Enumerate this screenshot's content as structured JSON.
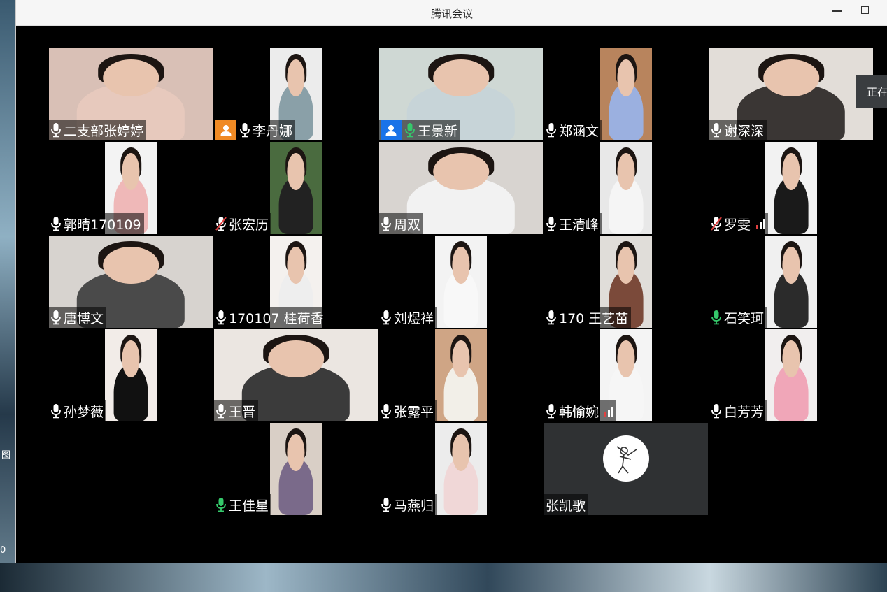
{
  "window": {
    "title": "腾讯会议"
  },
  "toast": {
    "text": "正在"
  },
  "desktop": {
    "left_fragment_1": "图",
    "left_fragment_2": "0"
  },
  "participants": [
    {
      "name": "二支部张婷婷",
      "mic": "on",
      "host": "none"
    },
    {
      "name": "李丹娜",
      "mic": "on",
      "host": "co-host"
    },
    {
      "name": "王景新",
      "mic": "active",
      "host": "host",
      "active": true
    },
    {
      "name": "郑涵文",
      "mic": "on",
      "host": "none"
    },
    {
      "name": "谢深深",
      "mic": "on",
      "host": "none"
    },
    {
      "name": "郭晴170109",
      "mic": "on",
      "host": "none"
    },
    {
      "name": "张宏历",
      "mic": "muted",
      "host": "none"
    },
    {
      "name": "周双",
      "mic": "on",
      "host": "none"
    },
    {
      "name": "王清峰",
      "mic": "on",
      "host": "none"
    },
    {
      "name": "罗雯",
      "mic": "muted",
      "host": "none",
      "signal": "weak"
    },
    {
      "name": "唐博文",
      "mic": "on",
      "host": "none"
    },
    {
      "name": "170107 桂荷香",
      "mic": "on",
      "host": "none"
    },
    {
      "name": "刘煜祥",
      "mic": "on",
      "host": "none"
    },
    {
      "name": "170 王艺苗",
      "mic": "on",
      "host": "none"
    },
    {
      "name": "石笑珂",
      "mic": "active",
      "host": "none"
    },
    {
      "name": "孙梦薇",
      "mic": "on",
      "host": "none"
    },
    {
      "name": "王晋",
      "mic": "on",
      "host": "none"
    },
    {
      "name": "张露平",
      "mic": "on",
      "host": "none"
    },
    {
      "name": "韩愉婉",
      "mic": "on",
      "host": "none",
      "signal": "weak"
    },
    {
      "name": "白芳芳",
      "mic": "on",
      "host": "none"
    },
    {
      "name": "王佳星",
      "mic": "active",
      "host": "none"
    },
    {
      "name": "马燕归",
      "mic": "on",
      "host": "none"
    },
    {
      "name": "张凯歌",
      "mic": "none",
      "host": "none",
      "video_off": true
    }
  ],
  "colors": {
    "mic_active": "#35c96b",
    "mic_muted_slash": "#e04040",
    "host_badge": "#1a73e8",
    "cohost_badge": "#f08a24",
    "active_border": "#29c27a"
  }
}
